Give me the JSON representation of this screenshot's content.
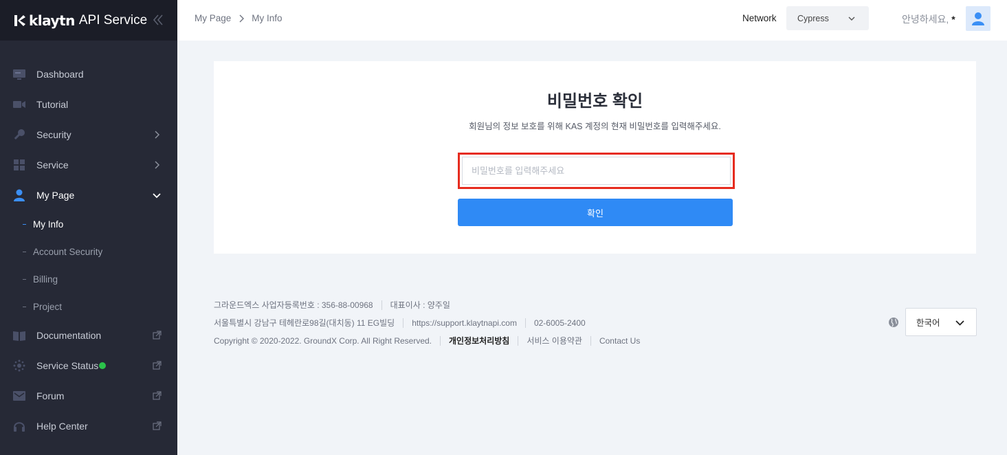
{
  "app": {
    "brand": "klaytn",
    "service": "API Service"
  },
  "sidebar": {
    "items": [
      {
        "label": "Dashboard",
        "icon": "monitor-icon"
      },
      {
        "label": "Tutorial",
        "icon": "video-icon"
      },
      {
        "label": "Security",
        "icon": "key-icon"
      },
      {
        "label": "Service",
        "icon": "grid-icon"
      },
      {
        "label": "My Page",
        "icon": "user-icon"
      },
      {
        "label": "Documentation",
        "icon": "book-icon"
      },
      {
        "label": "Service Status",
        "icon": "status-icon"
      },
      {
        "label": "Forum",
        "icon": "mail-icon"
      },
      {
        "label": "Help Center",
        "icon": "headphones-icon"
      }
    ],
    "mypage_sub": [
      {
        "label": "My Info"
      },
      {
        "label": "Account Security"
      },
      {
        "label": "Billing"
      },
      {
        "label": "Project"
      }
    ],
    "status_color": "#2bc24a"
  },
  "header": {
    "breadcrumb": [
      "My Page",
      "My Info"
    ],
    "network_label": "Network",
    "network_value": "Cypress",
    "greeting": "안녕하세요,",
    "username": "*"
  },
  "card": {
    "title": "비밀번호 확인",
    "description": "회원님의 정보 보호를 위해 KAS 계정의 현재 비밀번호를 입력해주세요.",
    "password_placeholder": "비밀번호를 입력해주세요",
    "confirm_label": "확인"
  },
  "footer": {
    "company": "그라운드엑스 사업자등록번호 : 356-88-00968",
    "ceo": "대표이사 : 양주일",
    "address": "서울특별시 강남구 테헤란로98길(대치동) 11 EG빌딩",
    "support_url": "https://support.klaytnapi.com",
    "phone": "02-6005-2400",
    "copyright": "Copyright © 2020-2022. GroundX Corp. All Right Reserved.",
    "privacy": "개인정보처리방침",
    "terms": "서비스 이용약관",
    "contact": "Contact Us",
    "language": "한국어"
  },
  "colors": {
    "accent": "#2f8af5",
    "highlight": "#e62b1e",
    "sidebar_bg": "#262936"
  }
}
